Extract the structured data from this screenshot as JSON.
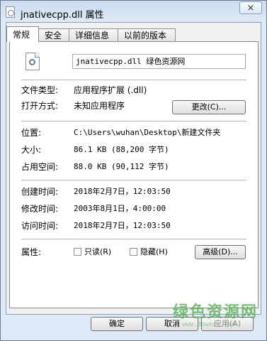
{
  "window": {
    "title": "jnativecpp.dll 属性",
    "close_glyph": "×"
  },
  "tabs": [
    {
      "label": "常规"
    },
    {
      "label": "安全"
    },
    {
      "label": "详细信息"
    },
    {
      "label": "以前的版本"
    }
  ],
  "general": {
    "file_name": "jnativecpp.dll 绿色资源网",
    "file_type_label": "文件类型:",
    "file_type_value": "应用程序扩展 (.dll)",
    "open_with_label": "打开方式:",
    "open_with_value": "未知应用程序",
    "change_button": "更改(C)...",
    "location_label": "位置:",
    "location_value": "C:\\Users\\wuhan\\Desktop\\新建文件夹",
    "size_label": "大小:",
    "size_value": "86.1 KB (88,200 字节)",
    "size_on_disk_label": "占用空间:",
    "size_on_disk_value": "88.0 KB (90,112 字节)",
    "created_label": "创建时间:",
    "created_value": "2018年2月7日，12:03:50",
    "modified_label": "修改时间:",
    "modified_value": "2003年8月1日，4:00:00",
    "accessed_label": "访问时间:",
    "accessed_value": "2018年2月7日，12:03:50",
    "attributes_label": "属性:",
    "readonly_label": "只读(R)",
    "hidden_label": "隐藏(H)",
    "advanced_button": "高级(D)..."
  },
  "footer": {
    "ok_button": "确定",
    "cancel_button": "取消",
    "apply_button": "应用(A)"
  },
  "watermark": {
    "text": "绿色资源网",
    "subtext": "www.downcc.com"
  }
}
